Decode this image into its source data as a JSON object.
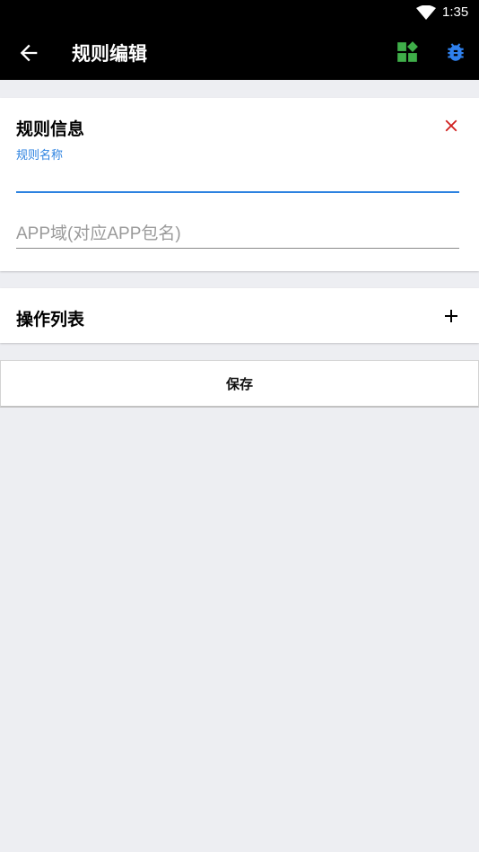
{
  "status_bar": {
    "time": "1:35",
    "wifi_icon": "wifi-icon"
  },
  "app_bar": {
    "title": "规则编辑",
    "back_icon": "arrow-back-icon",
    "actions": [
      {
        "icon": "widgets-icon",
        "color": "#3fae49"
      },
      {
        "icon": "bug-icon",
        "color": "#2f80ed"
      }
    ]
  },
  "rule_info": {
    "heading": "规则信息",
    "close_icon": "close-icon",
    "close_color": "#d0201f",
    "name_label": "规则名称",
    "name_value": "",
    "domain_placeholder": "APP域(对应APP包名)",
    "domain_value": ""
  },
  "operations": {
    "heading": "操作列表",
    "add_icon": "plus-icon"
  },
  "save_label": "保存",
  "colors": {
    "accent": "#2c82e0",
    "background": "#edeef2"
  }
}
